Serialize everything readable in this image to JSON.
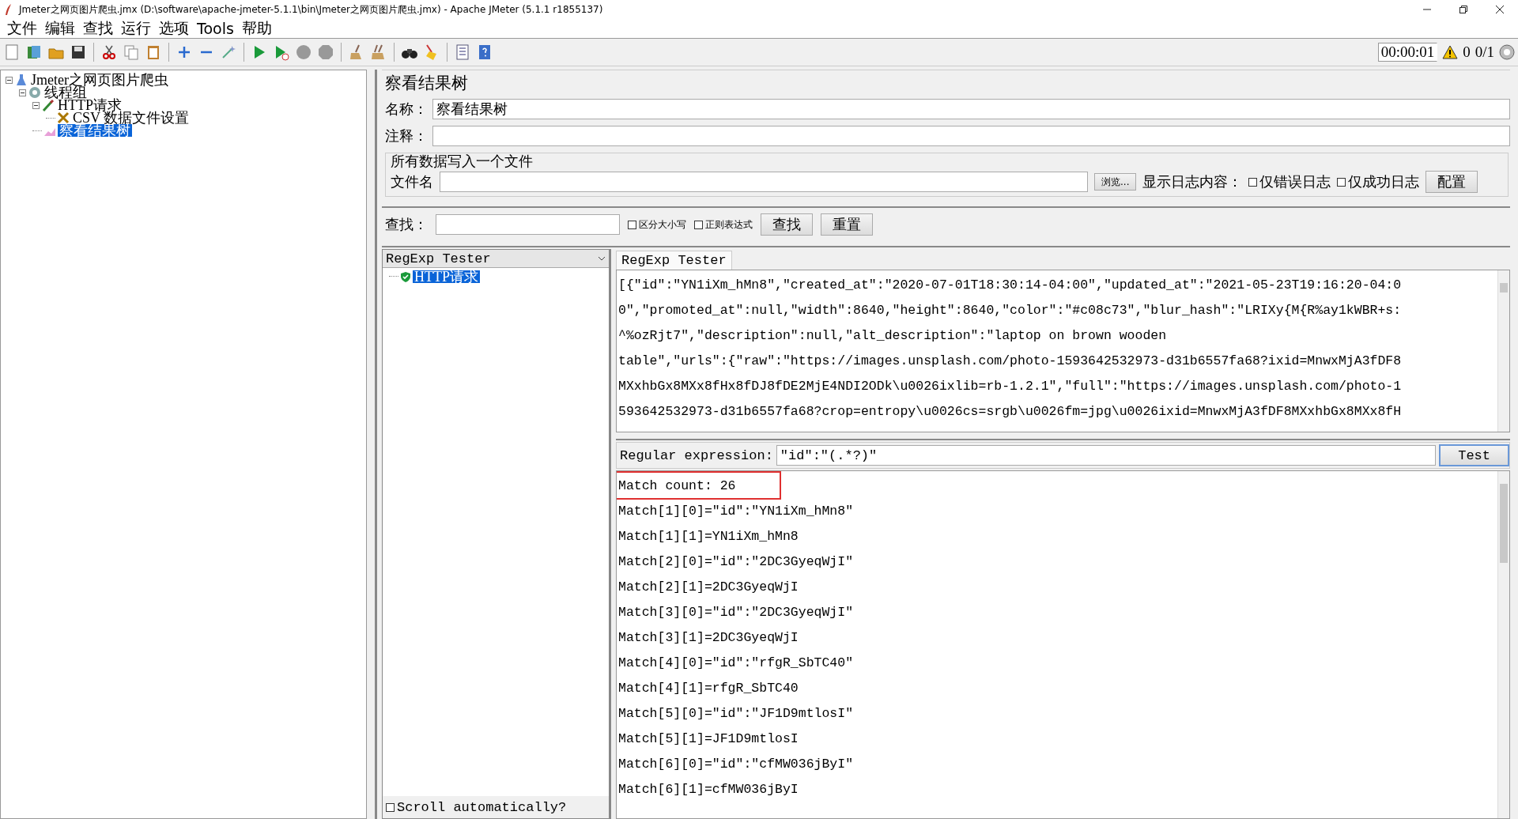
{
  "window": {
    "title": "Jmeter之网页图片爬虫.jmx (D:\\software\\apache-jmeter-5.1.1\\bin\\Jmeter之网页图片爬虫.jmx) - Apache JMeter (5.1.1 r1855137)"
  },
  "menu": [
    "文件",
    "编辑",
    "查找",
    "运行",
    "选项",
    "Tools",
    "帮助"
  ],
  "toolbar": [
    {
      "kind": "new"
    },
    {
      "kind": "templates"
    },
    {
      "kind": "open"
    },
    {
      "kind": "save"
    },
    {
      "kind": "sep"
    },
    {
      "kind": "cut"
    },
    {
      "kind": "copy"
    },
    {
      "kind": "paste"
    },
    {
      "kind": "sep"
    },
    {
      "kind": "expand"
    },
    {
      "kind": "collapse"
    },
    {
      "kind": "toggle"
    },
    {
      "kind": "sep"
    },
    {
      "kind": "start"
    },
    {
      "kind": "start-no-pause"
    },
    {
      "kind": "stop"
    },
    {
      "kind": "shutdown"
    },
    {
      "kind": "sep"
    },
    {
      "kind": "clear"
    },
    {
      "kind": "clear-all"
    },
    {
      "kind": "sep"
    },
    {
      "kind": "search"
    },
    {
      "kind": "reset-search"
    },
    {
      "kind": "sep"
    },
    {
      "kind": "function"
    },
    {
      "kind": "help"
    }
  ],
  "status": {
    "elapsed": "00:00:01",
    "errors": "0",
    "threads": "0/1"
  },
  "test_plan_tree": [
    {
      "label": "Jmeter之网页图片爬虫",
      "kind": "plan",
      "expanded": true,
      "selected": false,
      "children": [
        {
          "label": "线程组",
          "kind": "threads",
          "expanded": true,
          "selected": false,
          "children": [
            {
              "label": "HTTP请求",
              "kind": "sampler",
              "expanded": true,
              "selected": false,
              "children": [
                {
                  "label": "CSV 数据文件设置",
                  "kind": "config",
                  "selected": false
                }
              ]
            },
            {
              "label": "察看结果树",
              "kind": "listener",
              "selected": true
            }
          ]
        }
      ]
    }
  ],
  "panel": {
    "title": "察看结果树",
    "name_label": "名称：",
    "name_value": "察看结果树",
    "comment_label": "注释：",
    "file_group": {
      "title": "所有数据写入一个文件",
      "filename_label": "文件名",
      "browse_button": "浏览...",
      "log_label": "显示日志内容：",
      "options": [
        {
          "label": "仅错误日志",
          "checked": false
        },
        {
          "label": "仅成功日志",
          "checked": false
        }
      ],
      "configure_button": "配置"
    },
    "search": {
      "label": "查找：",
      "options": [
        {
          "label": "区分大小写",
          "checked": false
        },
        {
          "label": "正则表达式",
          "checked": false
        }
      ],
      "buttons": [
        "查找",
        "重置"
      ]
    },
    "renderer": "RegExp Tester",
    "result_tree": [
      {
        "label": "HTTP请求",
        "success": true,
        "selected": true
      }
    ],
    "scroll_automatically": {
      "label": "Scroll automatically?",
      "checked": false
    },
    "tabs": [
      {
        "label": "RegExp Tester",
        "selected": true
      }
    ],
    "response_lines": [
      "[{\"id\":\"YN1iXm_hMn8\",\"created_at\":\"2020-07-01T18:30:14-04:00\",\"updated_at\":\"2021-05-23T19:16:20-04:0",
      "0\",\"promoted_at\":null,\"width\":8640,\"height\":8640,\"color\":\"#c08c73\",\"blur_hash\":\"LRIXy{M{R%ay1kWBR+s:",
      "^%ozRjt7\",\"description\":null,\"alt_description\":\"laptop on brown wooden",
      "table\",\"urls\":{\"raw\":\"https://images.unsplash.com/photo-1593642532973-d31b6557fa68?ixid=MnwxMjA3fDF8",
      "MXxhbGx8MXx8fHx8fDJ8fDE2MjE4NDI2ODk\\u0026ixlib=rb-1.2.1\",\"full\":\"https://images.unsplash.com/photo-1",
      "593642532973-d31b6557fa68?crop=entropy\\u0026cs=srgb\\u0026fm=jpg\\u0026ixid=MnwxMjA3fDF8MXxhbGx8MXx8fH"
    ],
    "regex": {
      "label": "Regular expression:",
      "value": "\"id\":\"(.*?)\"",
      "button": "Test"
    },
    "result": {
      "match_count": "Match count: 26",
      "highlighted": true,
      "lines": [
        "Match[1][0]=\"id\":\"YN1iXm_hMn8\"",
        "Match[1][1]=YN1iXm_hMn8",
        "Match[2][0]=\"id\":\"2DC3GyeqWjI\"",
        "Match[2][1]=2DC3GyeqWjI",
        "Match[3][0]=\"id\":\"2DC3GyeqWjI\"",
        "Match[3][1]=2DC3GyeqWjI",
        "Match[4][0]=\"id\":\"rfgR_SbTC40\"",
        "Match[4][1]=rfgR_SbTC40",
        "Match[5][0]=\"id\":\"JF1D9mtlosI\"",
        "Match[5][1]=JF1D9mtlosI",
        "Match[6][0]=\"id\":\"cfMW036jByI\"",
        "Match[6][1]=cfMW036jByI"
      ]
    }
  }
}
